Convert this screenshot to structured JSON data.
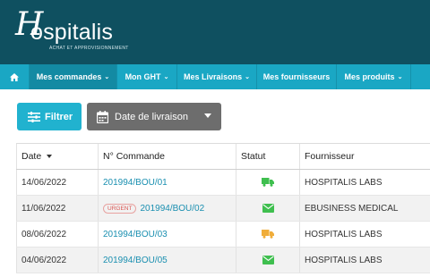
{
  "brand": {
    "name": "ospitalis",
    "initial": "H",
    "tagline": "ACHAT ET APPROVISIONNEMENT"
  },
  "nav": {
    "home_icon": "home-icon",
    "items": [
      {
        "label": "Mes commandes",
        "has_menu": true,
        "active": true
      },
      {
        "label": "Mon GHT",
        "has_menu": true
      },
      {
        "label": "Mes Livraisons",
        "has_menu": true
      },
      {
        "label": "Mes fournisseurs",
        "has_menu": false
      },
      {
        "label": "Mes produits",
        "has_menu": true
      }
    ]
  },
  "toolbar": {
    "filter_label": "Filtrer",
    "date_label": "Date de livraison"
  },
  "table": {
    "columns": [
      "Date",
      "N° Commande",
      "Statut",
      "Fournisseur"
    ],
    "rows": [
      {
        "date": "14/06/2022",
        "badge": "",
        "order": "201994/BOU/01",
        "status_icon": "truck-icon",
        "status_color": "#3fbf4f",
        "supplier": "HOSPITALIS LABS"
      },
      {
        "date": "11/06/2022",
        "badge": "URGENT",
        "order": "201994/BOU/02",
        "status_icon": "envelope-icon",
        "status_color": "#3fbf4f",
        "supplier": "EBUSINESS MEDICAL"
      },
      {
        "date": "08/06/2022",
        "badge": "",
        "order": "201994/BOU/03",
        "status_icon": "truck-icon",
        "status_color": "#f0ad3a",
        "supplier": "HOSPITALIS LABS"
      },
      {
        "date": "04/06/2022",
        "badge": "",
        "order": "201994/BOU/05",
        "status_icon": "envelope-icon",
        "status_color": "#3fbf4f",
        "supplier": "HOSPITALIS LABS"
      }
    ]
  },
  "colors": {
    "header_bg": "#0f5060",
    "nav_bg": "#1aa7c4",
    "filter_btn": "#21b2cf",
    "date_btn": "#6d6d6d",
    "link": "#1a8fb0"
  }
}
